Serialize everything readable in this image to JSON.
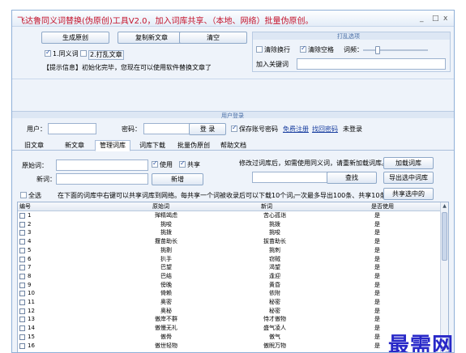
{
  "window": {
    "title": "飞达鲁同义词替换(伪原创)工具V2.0，加入词库共享、（本地、网络）批量伪原创。",
    "minimize": "_",
    "maximize": "□",
    "close": "x"
  },
  "top": {
    "gen_button": "生成原创",
    "copy_button": "复制新文章",
    "clear_button": "清空",
    "opt1": {
      "label": "1.同义词",
      "checked": true
    },
    "opt2": {
      "label": "2.打乱文章",
      "checked": false
    },
    "info": "【提示信息】初始化完毕，您现在可以使用软件替换文章了"
  },
  "shuffle": {
    "title": "打乱选项",
    "clear_newline": {
      "label": "清除换行",
      "checked": false
    },
    "clear_space": {
      "label": "清除空格",
      "checked": true
    },
    "freq_label": "词频：",
    "slider_level": 0.2,
    "keyword_label": "加入关键词",
    "keyword_value": ""
  },
  "login": {
    "title": "用户登录",
    "user_label": "用户：",
    "pwd_label": "密码：",
    "login_button": "登 录",
    "save_pwd": {
      "label": "保存账号密码",
      "checked": true
    },
    "register_link": "免费注册",
    "recover_link": "找回密码",
    "status": "未登录"
  },
  "tabs": [
    "旧文章",
    "新文章",
    "管理词库",
    "词库下载",
    "批量伪原创",
    "帮助文档"
  ],
  "active_tab": 2,
  "manage": {
    "orig_label": "原始词：",
    "new_label": "新词：",
    "use": {
      "label": "使用",
      "checked": true
    },
    "share": {
      "label": "共享",
      "checked": true
    },
    "add_button": "新增",
    "notice": "修改过词库后，如需使用同义词，请重新加载词库。",
    "reload_button": "加载词库",
    "search_button": "查找",
    "export_button": "导出选中词库",
    "select_all": {
      "label": "全选",
      "checked": false
    },
    "table_tip": "在下面的词库中右键可以共享词库到网络。每共享一个词被收录后可以下载10个词。",
    "limit_note": "一次最多导出100条、共享10条。",
    "share_button": "共享选中的"
  },
  "table": {
    "headers": [
      "编号",
      "原始词",
      "新词",
      "是否使用"
    ],
    "rows": [
      {
        "id": "1",
        "orig": "殚精竭虑",
        "new": "苦心孤诣",
        "use": "是"
      },
      {
        "id": "2",
        "orig": "挑唆",
        "new": "挑拨",
        "use": "是"
      },
      {
        "id": "3",
        "orig": "挑拨",
        "new": "挑唆",
        "use": "是"
      },
      {
        "id": "4",
        "orig": "揠苗助长",
        "new": "拔苗助长",
        "use": "是"
      },
      {
        "id": "5",
        "orig": "挑剔",
        "new": "挑刺",
        "use": "是"
      },
      {
        "id": "6",
        "orig": "扒手",
        "new": "窃贼",
        "use": "是"
      },
      {
        "id": "7",
        "orig": "巴望",
        "new": "渴望",
        "use": "是"
      },
      {
        "id": "8",
        "orig": "巴结",
        "new": "逢迎",
        "use": "是"
      },
      {
        "id": "9",
        "orig": "傍晚",
        "new": "黄昏",
        "use": "是"
      },
      {
        "id": "10",
        "orig": "倚赖",
        "new": "依附",
        "use": "是"
      },
      {
        "id": "11",
        "orig": "奥密",
        "new": "秘密",
        "use": "是"
      },
      {
        "id": "12",
        "orig": "奥秘",
        "new": "秘密",
        "use": "是"
      },
      {
        "id": "13",
        "orig": "傲岸不群",
        "new": "恃才傲物",
        "use": "是"
      },
      {
        "id": "14",
        "orig": "傲慢无礼",
        "new": "盛气凌人",
        "use": "是"
      },
      {
        "id": "15",
        "orig": "傲骨",
        "new": "傲气",
        "use": "是"
      },
      {
        "id": "16",
        "orig": "傲世轻物",
        "new": "傲睨万物",
        "use": "是"
      }
    ]
  },
  "watermark": "最需网"
}
